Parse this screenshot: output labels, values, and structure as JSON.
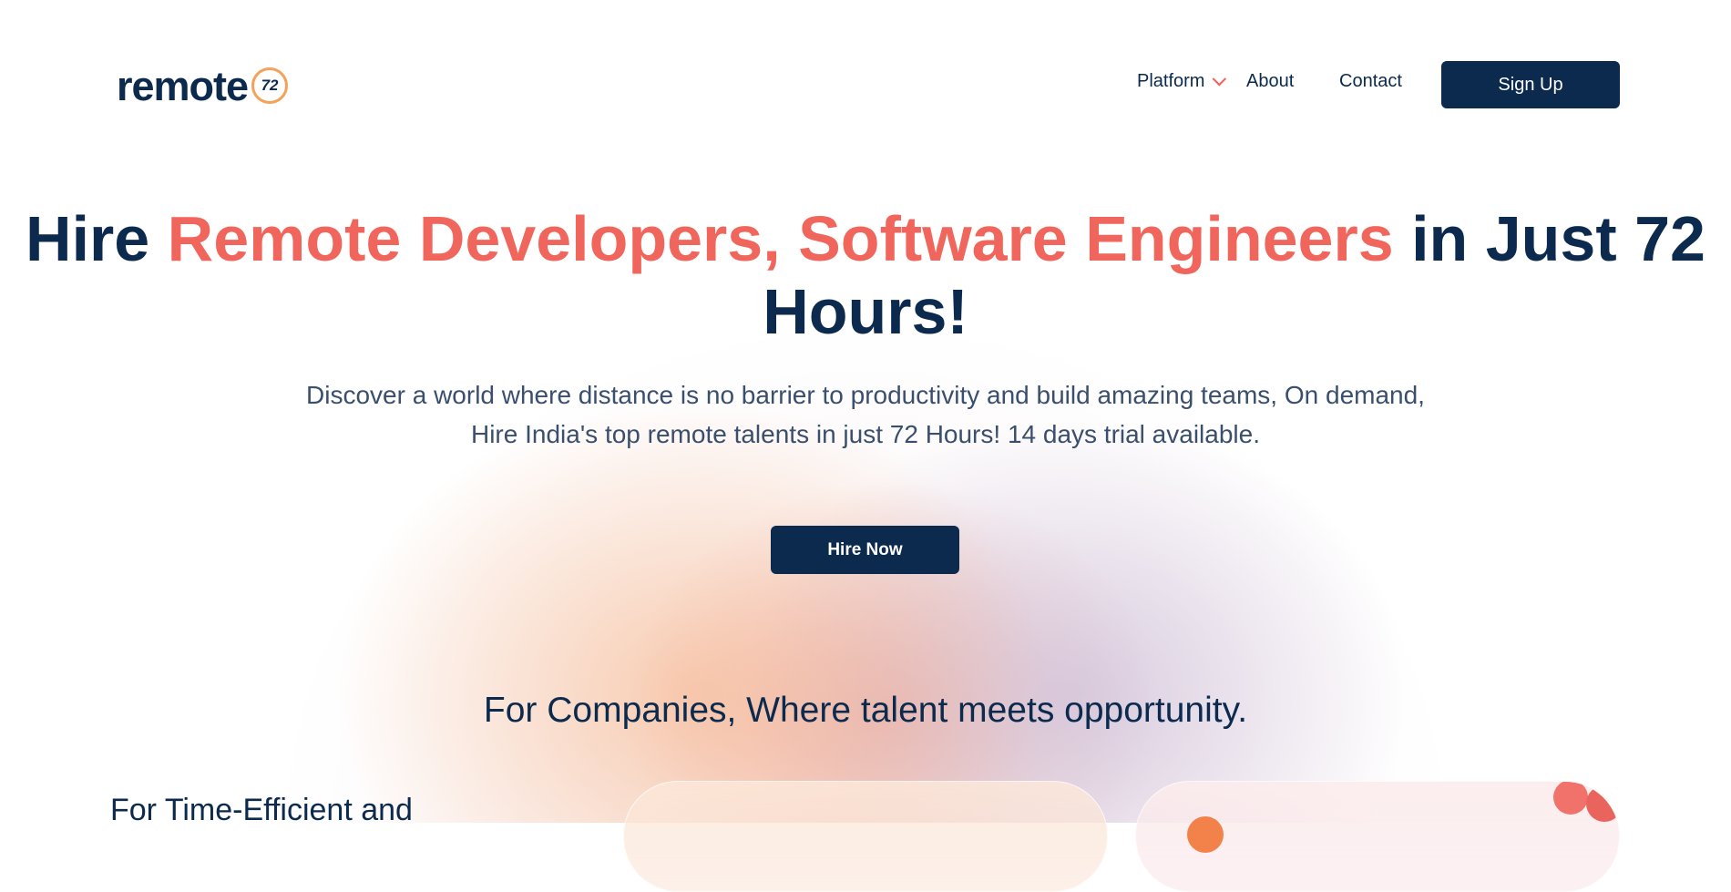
{
  "header": {
    "logo_text": "remote",
    "logo_badge": "72",
    "nav": {
      "platform": "Platform",
      "about": "About",
      "contact": "Contact"
    },
    "signup_label": "Sign Up"
  },
  "hero": {
    "title_part1": "Hire ",
    "title_accent": "Remote Developers, Software Engineers",
    "title_part2": " in Just 72 Hours!",
    "subtitle_line1": "Discover a world where distance is no barrier to productivity and build amazing teams, On demand,",
    "subtitle_line2": "Hire India's top remote talents in just 72 Hours! 14 days trial available.",
    "cta_label": "Hire Now"
  },
  "companies": {
    "title": "For Companies, Where talent meets opportunity.",
    "left_heading": "For Time-Efficient and"
  },
  "colors": {
    "navy": "#0b2a4d",
    "accent": "#f0665c",
    "logo_ring": "#f6a15a"
  },
  "icons": {
    "platform_dropdown": "chevron-down-icon"
  }
}
